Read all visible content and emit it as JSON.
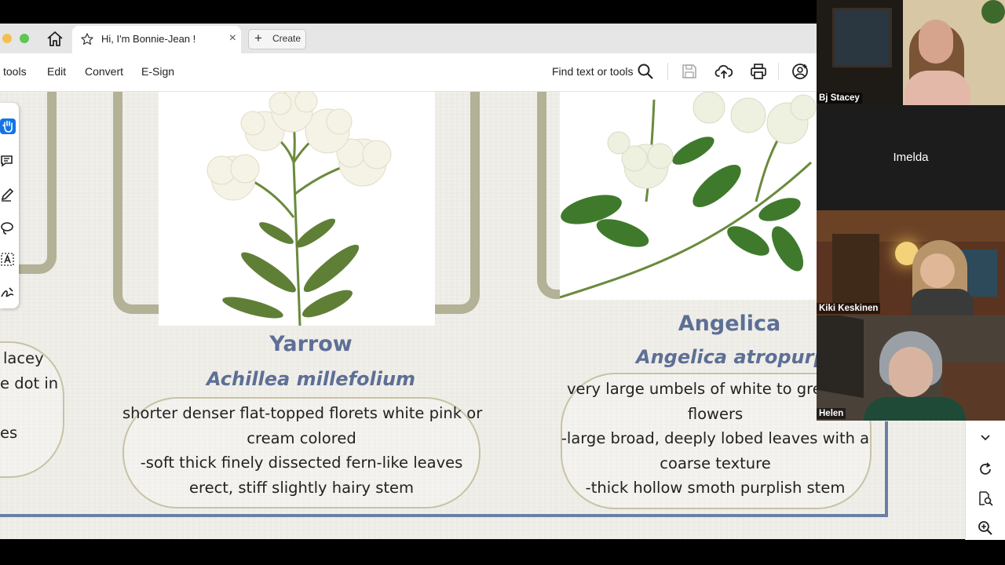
{
  "browser": {
    "tab_title": "Hi, I'm Bonnie-Jean !",
    "close_glyph": "×",
    "create_label": "Create",
    "plus_glyph": "+"
  },
  "toolbar": {
    "menu_items": [
      "l tools",
      "Edit",
      "Convert",
      "E-Sign"
    ],
    "find_label": "Find text or tools"
  },
  "document": {
    "left_partial_lines": [
      "lacey",
      "e dot in",
      "es"
    ],
    "plants": [
      {
        "name": "Yarrow",
        "latin": "Achillea millefolium",
        "lines": [
          "shorter denser flat-topped florets white pink or",
          "cream colored",
          "-soft thick finely dissected fern-like leaves",
          "erect, stiff slightly hairy stem"
        ]
      },
      {
        "name": "Angelica",
        "latin": "Angelica atropurpurea",
        "lines": [
          "very large umbels of white to greenish",
          "flowers",
          "-large broad, deeply lobed leaves with a",
          "coarse texture",
          "-thick hollow smoth purplish stem"
        ]
      }
    ]
  },
  "participants": [
    {
      "name": "Bj Stacey",
      "video": true
    },
    {
      "name": "Imelda",
      "video": false
    },
    {
      "name": "Kiki Keskinen",
      "video": true
    },
    {
      "name": "Helen",
      "video": true
    }
  ],
  "colors": {
    "accent_blue": "#5d6f96",
    "frame": "#b3b196",
    "page_bg": "#f1efea"
  },
  "icons": [
    "home-icon",
    "star-icon",
    "search-icon",
    "save-icon",
    "upload-icon",
    "print-icon",
    "account-icon",
    "hand-icon",
    "comment-icon",
    "pen-icon",
    "lasso-icon",
    "text-select-icon",
    "sign-icon",
    "chevron-down-icon",
    "refresh-icon",
    "page-search-icon",
    "zoom-in-icon"
  ]
}
